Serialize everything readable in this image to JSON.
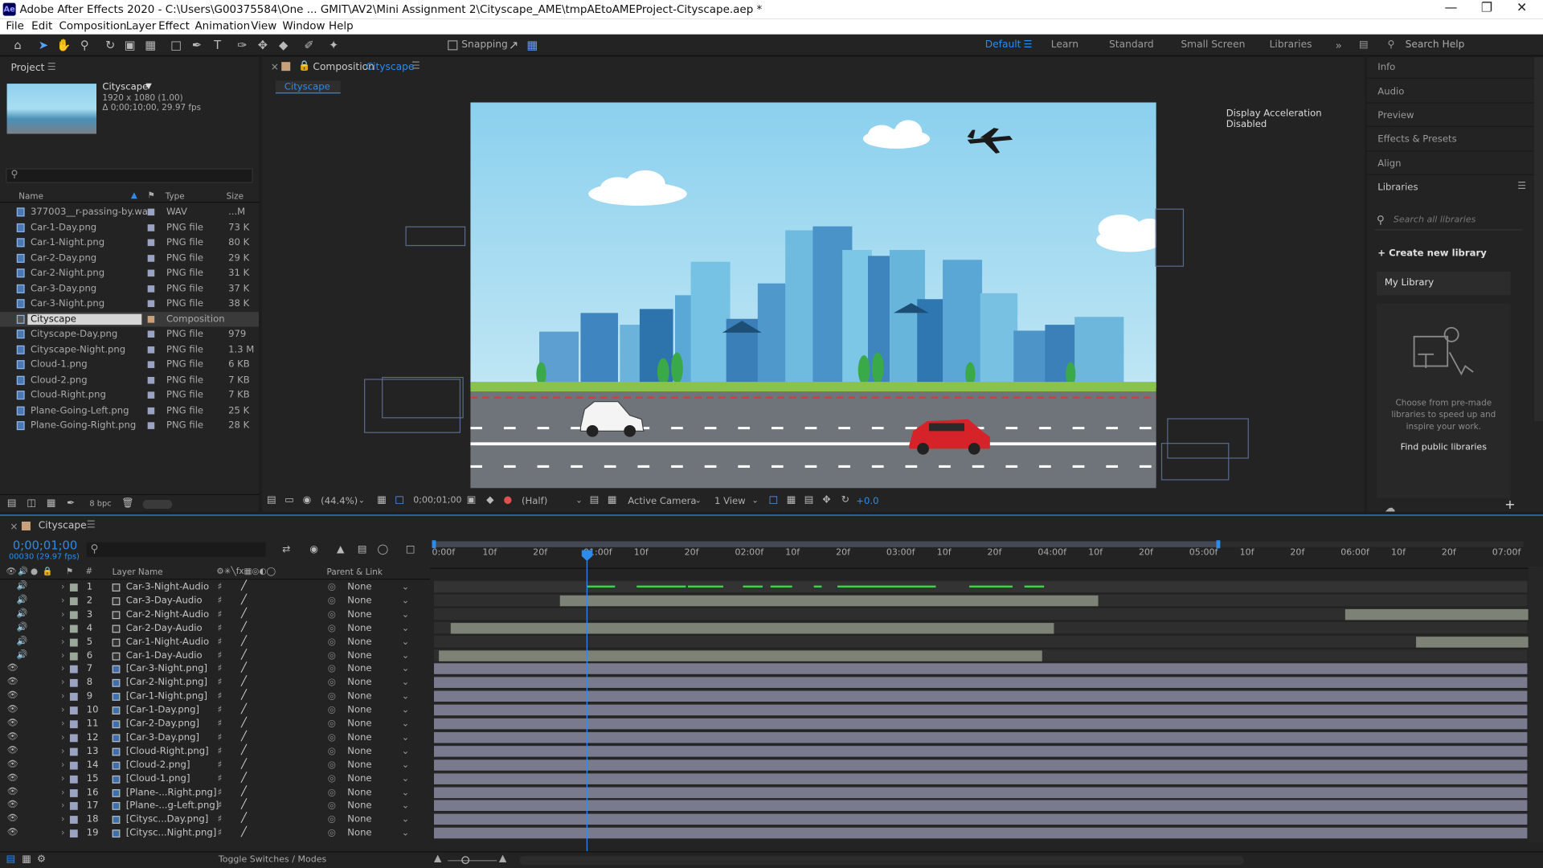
{
  "app": {
    "title": "Adobe After Effects 2020 - C:\\Users\\G00375584\\One ... GMIT\\AV2\\Mini Assignment 2\\Cityscape_AME\\tmpAEtoAMEProject-Cityscape.aep *",
    "logo": "Ae"
  },
  "menu": [
    "File",
    "Edit",
    "Composition",
    "Layer",
    "Effect",
    "Animation",
    "View",
    "Window",
    "Help"
  ],
  "toolbar": {
    "snapping": "Snapping",
    "workspaces": [
      "Default",
      "Learn",
      "Standard",
      "Small Screen",
      "Libraries"
    ],
    "search_help": "Search Help"
  },
  "project": {
    "tab": "Project",
    "comp_name": "Cityscape",
    "comp_res": "1920 x 1080 (1.00)",
    "comp_dur": "Δ 0;00;10;00, 29.97 fps",
    "columns": {
      "name": "Name",
      "type": "Type",
      "size": "Size"
    },
    "items": [
      {
        "name": "377003__r-passing-by.wav",
        "type": "WAV",
        "size": "...M",
        "icon": "audio-file-icon"
      },
      {
        "name": "Car-1-Day.png",
        "type": "PNG file",
        "size": "73 K"
      },
      {
        "name": "Car-1-Night.png",
        "type": "PNG file",
        "size": "80 K"
      },
      {
        "name": "Car-2-Day.png",
        "type": "PNG file",
        "size": "29 K"
      },
      {
        "name": "Car-2-Night.png",
        "type": "PNG file",
        "size": "31 K"
      },
      {
        "name": "Car-3-Day.png",
        "type": "PNG file",
        "size": "37 K"
      },
      {
        "name": "Car-3-Night.png",
        "type": "PNG file",
        "size": "38 K"
      },
      {
        "name": "Cityscape",
        "type": "Composition",
        "size": "",
        "selected": true
      },
      {
        "name": "Cityscape-Day.png",
        "type": "PNG file",
        "size": "979"
      },
      {
        "name": "Cityscape-Night.png",
        "type": "PNG file",
        "size": "1.3 M"
      },
      {
        "name": "Cloud-1.png",
        "type": "PNG file",
        "size": "6 KB"
      },
      {
        "name": "Cloud-2.png",
        "type": "PNG file",
        "size": "7 KB"
      },
      {
        "name": "Cloud-Right.png",
        "type": "PNG file",
        "size": "7 KB"
      },
      {
        "name": "Plane-Going-Left.png",
        "type": "PNG file",
        "size": "25 K"
      },
      {
        "name": "Plane-Going-Right.png",
        "type": "PNG file",
        "size": "28 K"
      }
    ],
    "bpc": "8 bpc"
  },
  "composition": {
    "tab_prefix": "Composition",
    "tab_name": "Cityscape",
    "subtab": "Cityscape",
    "display_note": "Display Acceleration Disabled",
    "zoom": "(44.4%)",
    "time": "0;00;01;00",
    "resolution": "(Half)",
    "camera": "Active Camera",
    "views": "1 View",
    "exposure": "+0.0"
  },
  "right": {
    "panels": [
      "Info",
      "Audio",
      "Preview",
      "Effects & Presets",
      "Align",
      "Libraries"
    ],
    "lib_search": "Search all libraries",
    "create_lib": "Create new library",
    "my_library": "My Library",
    "promo": "Choose from pre-made libraries to speed up and inspire your work.",
    "find_public": "Find public libraries"
  },
  "timeline": {
    "tab": "Cityscape",
    "current_time": "0;00;01;00",
    "fps_note": "00030 (29.97 fps)",
    "layer_name_header": "Layer Name",
    "parent_header": "Parent & Link",
    "ruler": [
      "0:00f",
      "10f",
      "20f",
      "01:00f",
      "10f",
      "20f",
      "02:00f",
      "10f",
      "20f",
      "03:00f",
      "10f",
      "20f",
      "04:00f",
      "10f",
      "20f",
      "05:00f",
      "10f",
      "20f",
      "06:00f",
      "10f",
      "20f",
      "07:00f"
    ],
    "toggle": "Toggle Switches / Modes",
    "layers": [
      {
        "num": "1",
        "name": "Car-3-Night-Audio",
        "audio": true,
        "parent": "None"
      },
      {
        "num": "2",
        "name": "Car-3-Day-Audio",
        "audio": true,
        "parent": "None"
      },
      {
        "num": "3",
        "name": "Car-2-Night-Audio",
        "audio": true,
        "parent": "None"
      },
      {
        "num": "4",
        "name": "Car-2-Day-Audio",
        "audio": true,
        "parent": "None"
      },
      {
        "num": "5",
        "name": "Car-1-Night-Audio",
        "audio": true,
        "parent": "None"
      },
      {
        "num": "6",
        "name": "Car-1-Day-Audio",
        "audio": true,
        "parent": "None"
      },
      {
        "num": "7",
        "name": "[Car-3-Night.png]",
        "audio": false,
        "parent": "None"
      },
      {
        "num": "8",
        "name": "[Car-2-Night.png]",
        "audio": false,
        "parent": "None"
      },
      {
        "num": "9",
        "name": "[Car-1-Night.png]",
        "audio": false,
        "parent": "None"
      },
      {
        "num": "10",
        "name": "[Car-1-Day.png]",
        "audio": false,
        "parent": "None"
      },
      {
        "num": "11",
        "name": "[Car-2-Day.png]",
        "audio": false,
        "parent": "None"
      },
      {
        "num": "12",
        "name": "[Car-3-Day.png]",
        "audio": false,
        "parent": "None"
      },
      {
        "num": "13",
        "name": "[Cloud-Right.png]",
        "audio": false,
        "parent": "None"
      },
      {
        "num": "14",
        "name": "[Cloud-2.png]",
        "audio": false,
        "parent": "None"
      },
      {
        "num": "15",
        "name": "[Cloud-1.png]",
        "audio": false,
        "parent": "None"
      },
      {
        "num": "16",
        "name": "[Plane-...Right.png]",
        "audio": false,
        "parent": "None"
      },
      {
        "num": "17",
        "name": "[Plane-...g-Left.png]",
        "audio": false,
        "parent": "None"
      },
      {
        "num": "18",
        "name": "[Citysc...Day.png]",
        "audio": false,
        "parent": "None"
      },
      {
        "num": "19",
        "name": "[Citysc...Night.png]",
        "audio": false,
        "parent": "None"
      }
    ]
  },
  "colors": {
    "accent": "#2d8ceb",
    "audio_bar": "#7d8276",
    "video_bar": "#7a7a8e",
    "selection": "#d6d6d6"
  }
}
